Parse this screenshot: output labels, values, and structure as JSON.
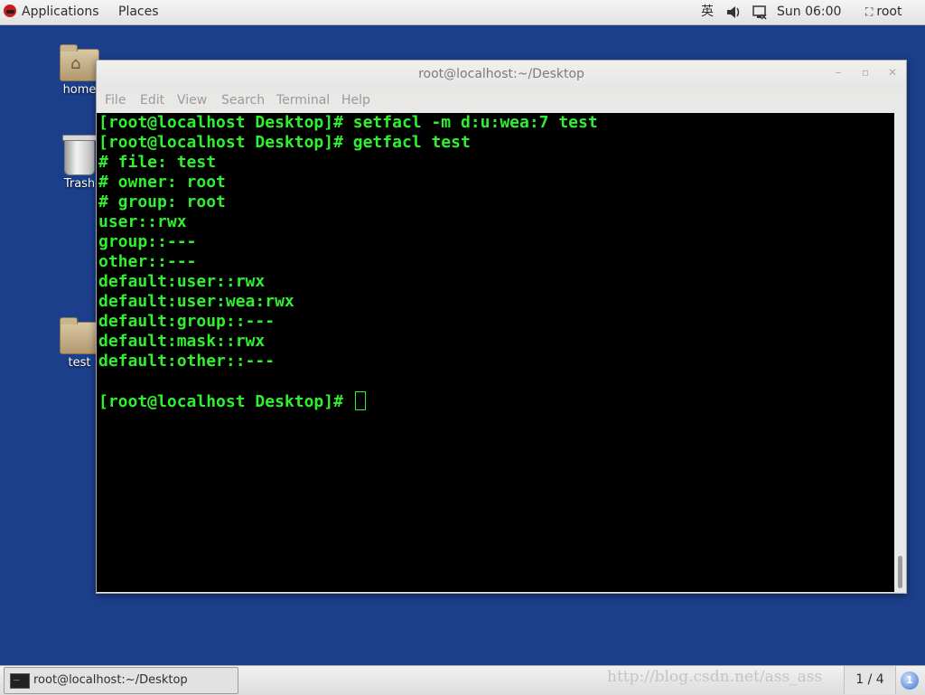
{
  "top_panel": {
    "applications": "Applications",
    "places": "Places",
    "ime": "英",
    "volume_icon": "speaker-icon",
    "network_icon": "network-icon",
    "clock": "Sun 06:00",
    "user": "root"
  },
  "desktop": {
    "icons": [
      {
        "label": "home",
        "icon": "home-folder-icon"
      },
      {
        "label": "Trash",
        "icon": "trash-icon"
      },
      {
        "label": "test",
        "icon": "folder-icon"
      }
    ]
  },
  "window": {
    "title": "root@localhost:~/Desktop",
    "menu": [
      "File",
      "Edit",
      "View",
      "Search",
      "Terminal",
      "Help"
    ]
  },
  "terminal": {
    "lines": [
      "[root@localhost Desktop]# setfacl -m d:u:wea:7 test",
      "[root@localhost Desktop]# getfacl test",
      "# file: test",
      "# owner: root",
      "# group: root",
      "user::rwx",
      "group::---",
      "other::---",
      "default:user::rwx",
      "default:user:wea:rwx",
      "default:group::---",
      "default:mask::rwx",
      "default:other::---",
      "",
      "[root@localhost Desktop]# "
    ]
  },
  "taskbar": {
    "task_label": "root@localhost:~/Desktop",
    "watermark": "http://blog.csdn.net/ass_ass",
    "workspace": "1 / 4",
    "notification_count": "1"
  },
  "colors": {
    "desktop_bg": "#1c3f8c",
    "terminal_bg": "#000000",
    "terminal_fg": "#2ef02e"
  }
}
